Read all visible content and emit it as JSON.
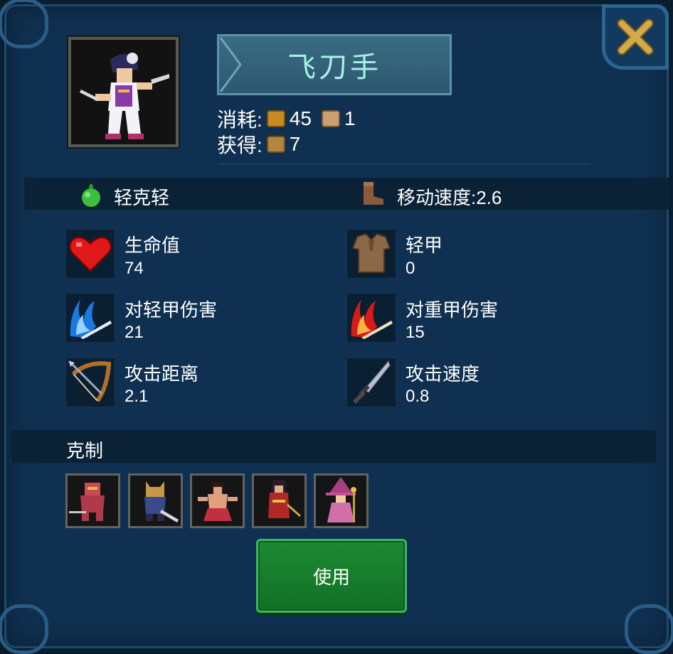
{
  "unit": {
    "name": "飞刀手",
    "cost_label": "消耗:",
    "cost_gold": "45",
    "cost_pop": "1",
    "gain_label": "获得:",
    "gain_value": "7"
  },
  "band": {
    "type_text": "轻克轻",
    "move_speed": "移动速度:2.6"
  },
  "stats": [
    {
      "label": "生命值",
      "value": "74",
      "icon": "heart-icon"
    },
    {
      "label": "轻甲",
      "value": "0",
      "icon": "light-armor-icon"
    },
    {
      "label": "对轻甲伤害",
      "value": "21",
      "icon": "blue-slash-icon"
    },
    {
      "label": "对重甲伤害",
      "value": "15",
      "icon": "red-slash-icon"
    },
    {
      "label": "攻击距离",
      "value": "2.1",
      "icon": "bow-icon"
    },
    {
      "label": "攻击速度",
      "value": "0.8",
      "icon": "dagger-icon"
    }
  ],
  "counters": {
    "label": "克制",
    "units": [
      "knight-unit-icon",
      "cat-warrior-unit-icon",
      "monk-unit-icon",
      "red-swordsman-unit-icon",
      "witch-unit-icon"
    ]
  },
  "use_button": "使用",
  "colors": {
    "panel": "#0f3050",
    "accent_border": "#2b6592",
    "title_text": "#a8f0e8",
    "button_green": "#1c8a32",
    "close_x": "#d4a94a"
  }
}
